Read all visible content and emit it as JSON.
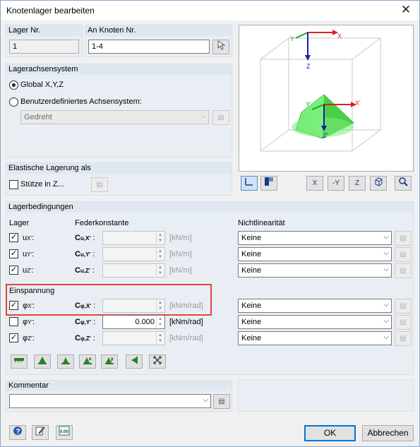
{
  "window": {
    "title": "Knotenlager bearbeiten",
    "close_label": "✕"
  },
  "lager_nr": {
    "header": "Lager Nr.",
    "value": "1"
  },
  "an_knoten": {
    "header": "An Knoten Nr.",
    "value": "1-4"
  },
  "lagerachsensystem": {
    "header": "Lagerachsensystem",
    "global_label": "Global X,Y,Z",
    "custom_label": "Benutzerdefiniertes Achsensystem:",
    "custom_selected": "Gedreht"
  },
  "elastisch": {
    "header": "Elastische Lagerung als",
    "stuetze_label": "Stütze in Z..."
  },
  "preview": {
    "axes_global": {
      "x": "X",
      "y": "Y",
      "z": "Z"
    },
    "axes_local": {
      "x": "X'",
      "y": "Y'",
      "z": "Z'"
    },
    "colors": {
      "x": "#e02020",
      "y": "#20a020",
      "z": "#1a1aa8",
      "support": "#5de65d"
    }
  },
  "view_buttons": [
    "X",
    "-Y",
    "Z"
  ],
  "bedingungen": {
    "header": "Lagerbedingungen",
    "col_lager": "Lager",
    "col_feder": "Federkonstante",
    "col_nl": "Nichtlinearität",
    "einspannung_label": "Einspannung",
    "rows": [
      {
        "sym": "u",
        "sub": "X'",
        "checked": true,
        "const_sym": "C",
        "const_sub": "u,X'",
        "value": "",
        "unit": "[kN/m]",
        "nl": "Keine"
      },
      {
        "sym": "u",
        "sub": "Y'",
        "checked": true,
        "const_sym": "C",
        "const_sub": "u,Y'",
        "value": "",
        "unit": "[kN/m]",
        "nl": "Keine"
      },
      {
        "sym": "u",
        "sub": "Z'",
        "checked": true,
        "const_sym": "C",
        "const_sub": "u,Z'",
        "value": "",
        "unit": "[kN/m]",
        "nl": "Keine"
      },
      {
        "sym": "φ",
        "sub": "X'",
        "checked": true,
        "const_sym": "C",
        "const_sub": "φ,X'",
        "value": "",
        "unit": "[kNm/rad]",
        "nl": "Keine"
      },
      {
        "sym": "φ",
        "sub": "Y'",
        "checked": false,
        "const_sym": "C",
        "const_sub": "φ,Y'",
        "value": "0.000",
        "unit": "[kNm/rad]",
        "nl": "Keine"
      },
      {
        "sym": "φ",
        "sub": "Z'",
        "checked": true,
        "const_sym": "C",
        "const_sub": "φ,Z'",
        "value": "",
        "unit": "[kNm/rad]",
        "nl": "Keine"
      }
    ],
    "separator": ":"
  },
  "kommentar": {
    "header": "Kommentar",
    "value": ""
  },
  "footer": {
    "ok": "OK",
    "cancel": "Abbrechen",
    "units_icon_label": "0.00"
  }
}
